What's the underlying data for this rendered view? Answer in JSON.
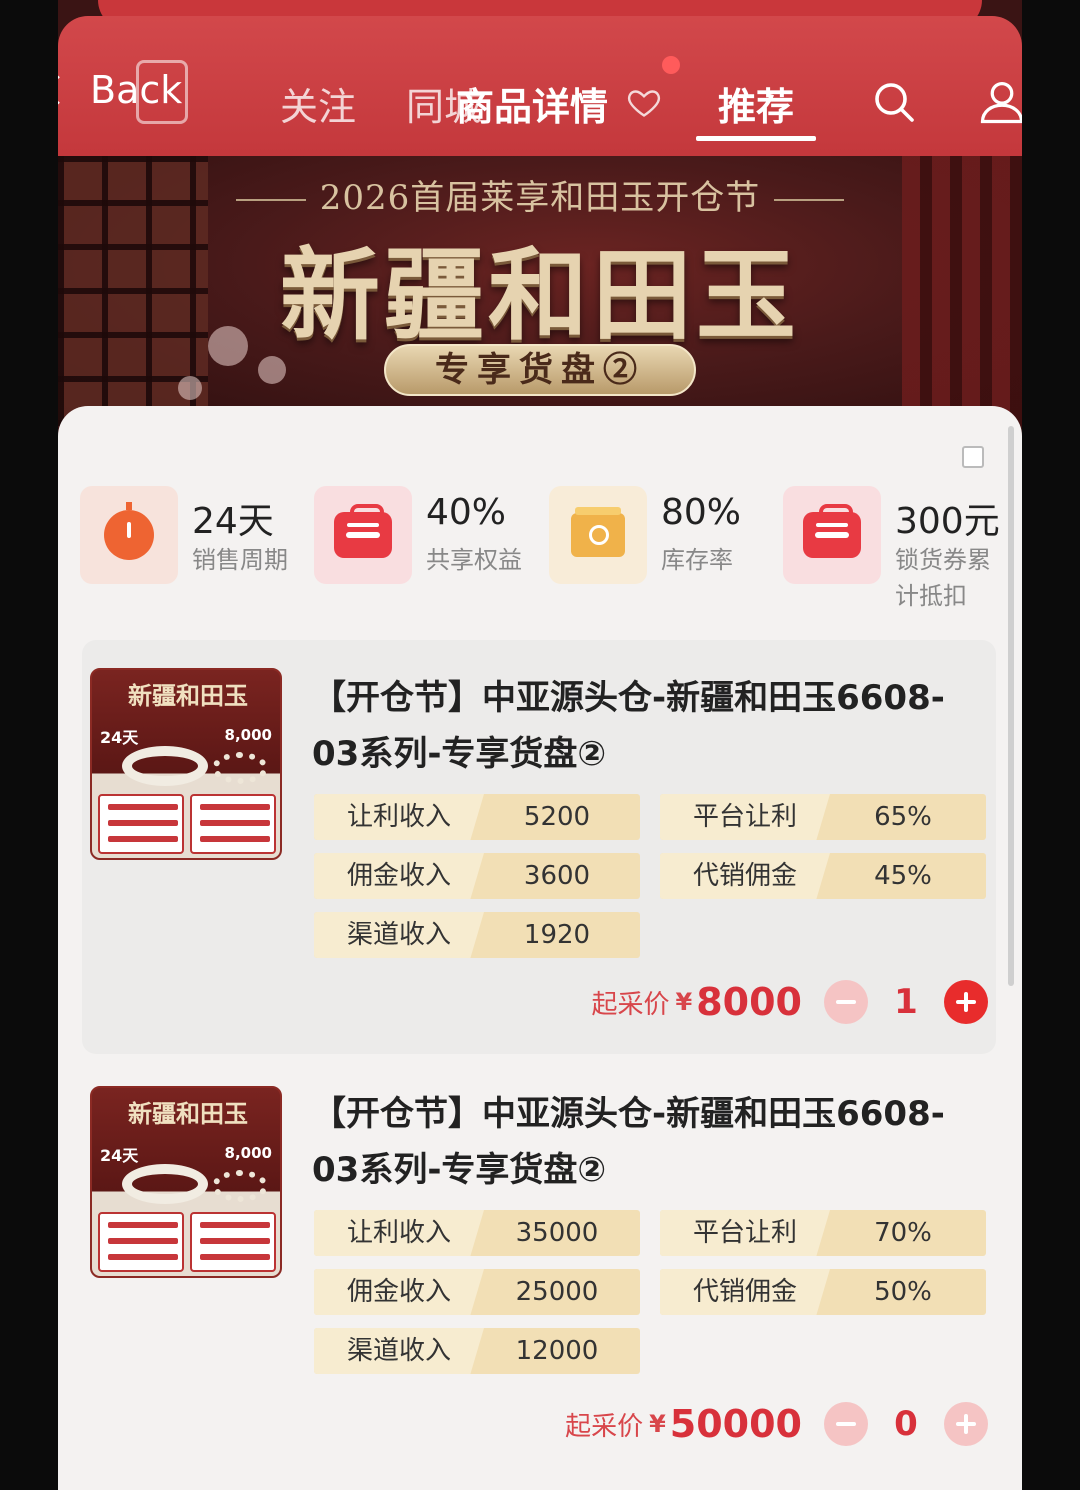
{
  "nav": {
    "back_label": "Back",
    "tabs": [
      "关注",
      "同城",
      "商品详情",
      "推荐"
    ],
    "active_tab": "推荐"
  },
  "banner": {
    "subtitle": "2026首届莱享和田玉开仓节",
    "title": "新疆和田玉",
    "pill": "专享货盘②"
  },
  "stats": [
    {
      "value": "24天",
      "label": "销售周期",
      "icon": "timer-icon"
    },
    {
      "value": "40%",
      "label": "共享权益",
      "icon": "bag-icon"
    },
    {
      "value": "80%",
      "label": "库存率",
      "icon": "box-icon"
    },
    {
      "value": "300元",
      "label": "锁货券累计抵扣",
      "icon": "bag-icon"
    }
  ],
  "products": [
    {
      "title": "【开仓节】中亚源头仓-新疆和田玉6608-03系列-专享货盘②",
      "thumb": {
        "title": "新疆和田玉",
        "badge_left": "24天",
        "badge_right": "8,000"
      },
      "metrics": {
        "rangli_label": "让利收入",
        "rangli_value": "5200",
        "platform_label": "平台让利",
        "platform_value": "65%",
        "commission_label": "佣金收入",
        "commission_value": "3600",
        "consign_label": "代销佣金",
        "consign_value": "45%",
        "channel_label": "渠道收入",
        "channel_value": "1920"
      },
      "price_label": "起采价",
      "currency": "¥",
      "price": "8000",
      "quantity": "1"
    },
    {
      "title": "【开仓节】中亚源头仓-新疆和田玉6608-03系列-专享货盘②",
      "thumb": {
        "title": "新疆和田玉",
        "badge_left": "24天",
        "badge_right": "8,000"
      },
      "metrics": {
        "rangli_label": "让利收入",
        "rangli_value": "35000",
        "platform_label": "平台让利",
        "platform_value": "70%",
        "commission_label": "佣金收入",
        "commission_value": "25000",
        "consign_label": "代销佣金",
        "consign_value": "50%",
        "channel_label": "渠道收入",
        "channel_value": "12000"
      },
      "price_label": "起采价",
      "currency": "¥",
      "price": "50000",
      "quantity": "0"
    }
  ],
  "colors": {
    "header": "#c9373b",
    "accent": "#d8313b",
    "metric_bg": "#f2dfb5"
  }
}
